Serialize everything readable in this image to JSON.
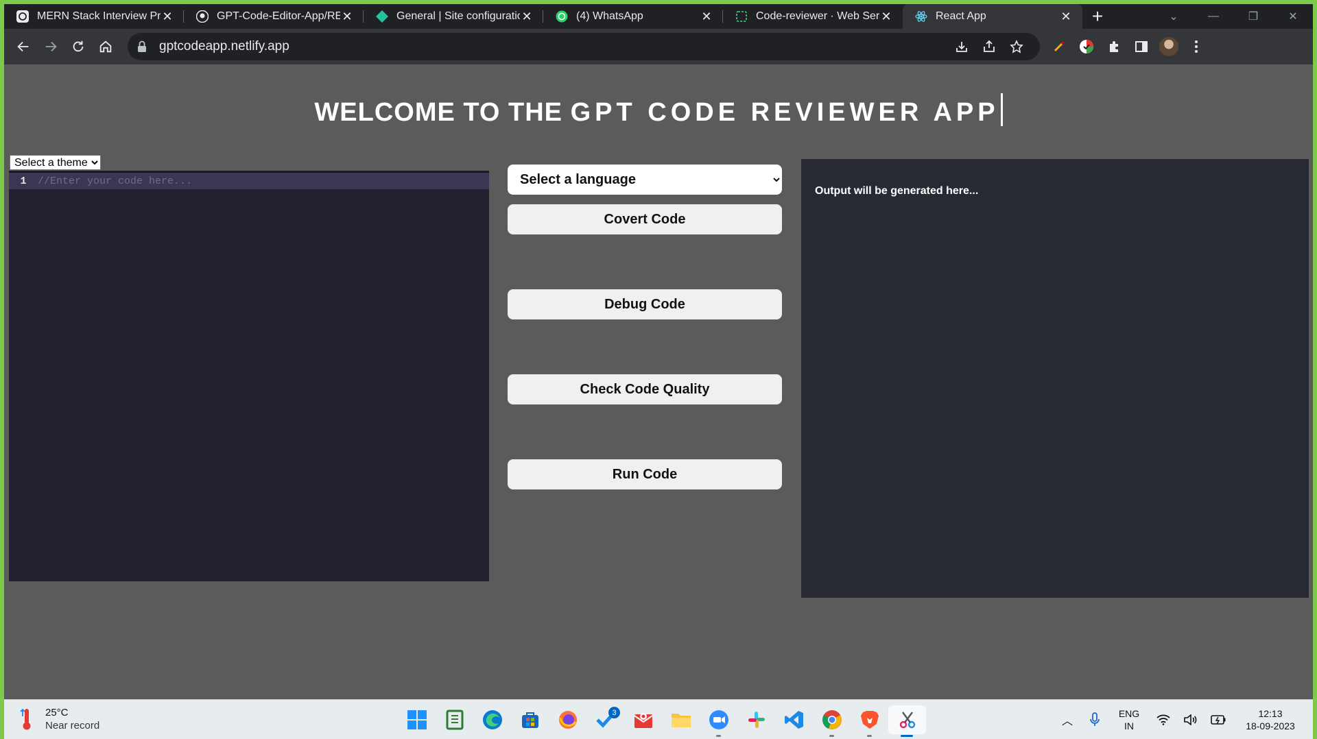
{
  "browser": {
    "tabs": [
      {
        "title": "MERN Stack Interview Prep",
        "icon": "chatgpt-icon",
        "active": false
      },
      {
        "title": "GPT-Code-Editor-App/README",
        "icon": "github-icon",
        "active": false
      },
      {
        "title": "General | Site configuration",
        "icon": "netlify-icon",
        "active": false
      },
      {
        "title": "(4) WhatsApp",
        "icon": "whatsapp-icon",
        "active": false
      },
      {
        "title": "Code-reviewer · Web Servi",
        "icon": "render-icon",
        "active": false
      },
      {
        "title": "React App",
        "icon": "react-icon",
        "active": true
      }
    ],
    "new_tab_label": "+",
    "url": "gptcodeapp.netlify.app"
  },
  "app": {
    "heading_static": "WELCOME TO THE ",
    "heading_typed": "GPT CODE REVIEWER APP",
    "theme_select": {
      "selected": "Select a theme"
    },
    "editor": {
      "line_number": "1",
      "placeholder": "//Enter your code here..."
    },
    "language_select": {
      "selected": "Select a language"
    },
    "buttons": {
      "convert": "Covert Code",
      "debug": "Debug Code",
      "quality": "Check Code Quality",
      "run": "Run Code"
    },
    "output_text": "Output will be generated here..."
  },
  "taskbar": {
    "weather": {
      "temp": "25°C",
      "note": "Near record"
    },
    "notification_badge": "3",
    "language": {
      "line1": "ENG",
      "line2": "IN"
    },
    "time": "12:13",
    "date": "18-09-2023"
  },
  "colors": {
    "page_bg": "#5b5b5b",
    "editor_bg": "#23202f",
    "output_bg": "#282a33",
    "button_bg": "#f0f0f0",
    "chrome_dark": "#202124",
    "chrome_toolbar": "#35363a"
  }
}
